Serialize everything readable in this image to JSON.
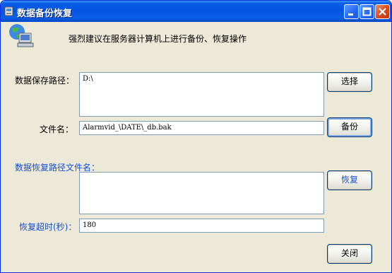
{
  "window": {
    "title": "数据备份恢复"
  },
  "header": {
    "hint": "强烈建议在服务器计算机上进行备份、恢复操作"
  },
  "backup": {
    "path_label": "数据保存路径：",
    "path_value": "D:\\",
    "filename_label": "文件名：",
    "filename_value": "Alarmvid_\\DATE\\_db.bak",
    "select_button": "选择",
    "backup_button": "备份"
  },
  "restore": {
    "path_label": "数据恢复路径文件名：",
    "path_value": "",
    "restore_button": "恢复",
    "timeout_label": "恢复超时(秒)：",
    "timeout_value": "180"
  },
  "footer": {
    "close_button": "关闭"
  },
  "colors": {
    "titlebar": "#0554e3",
    "window_bg": "#ece9d8",
    "accent_text": "#1a4fd1"
  },
  "icons": [
    "app-icon",
    "network-computer-icon",
    "minimize-icon",
    "maximize-icon",
    "close-icon"
  ]
}
